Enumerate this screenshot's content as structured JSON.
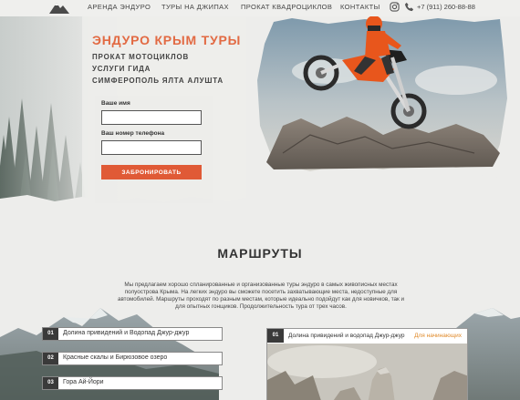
{
  "nav": {
    "items": [
      "АРЕНДА ЭНДУРО",
      "ТУРЫ НА ДЖИПАХ",
      "ПРОКАТ КВАДРОЦИКЛОВ",
      "КОНТАКТЫ"
    ],
    "phone": "+7 (911) 260-88-88"
  },
  "hero": {
    "title": "ЭНДУРО КРЫМ ТУРЫ",
    "lines": [
      "ПРОКАТ МОТОЦИКЛОВ",
      "УСЛУГИ ГИДА",
      "СИМФЕРОПОЛЬ ЯЛТА АЛУШТА"
    ]
  },
  "form": {
    "name_label": "Ваше имя",
    "name_value": "",
    "phone_label": "Ваш номер телефона",
    "phone_value": "",
    "button": "ЗАБРОНИРОВАТЬ"
  },
  "routes": {
    "title": "МАРШРУТЫ",
    "description": "Мы предлагаем хорошо спланированные и организованные туры эндуро в самых живописных местах полуострова Крыма. На легких эндуро вы сможете посетить захватывающие места, недоступные для автомобилей. Маршруты проходят по разным местам, которые идеально подойдут как для новичков, так и для опытных гонщиков. Продолжительность тура от трех часов.",
    "items": [
      {
        "num": "01",
        "name": "Долина привидений и Водопад Джур-джур"
      },
      {
        "num": "02",
        "name": "Красные скалы и Бирюзовое озеро"
      },
      {
        "num": "03",
        "name": "Гора Ай-Йори"
      }
    ],
    "card": {
      "num": "01",
      "title": "Долина привидений и водопад Джур-джур",
      "level": "Для начинающих"
    }
  },
  "colors": {
    "accent": "#e26a43",
    "button": "#e05a36",
    "level": "#e08a2a",
    "dark": "#3a3a3a"
  }
}
